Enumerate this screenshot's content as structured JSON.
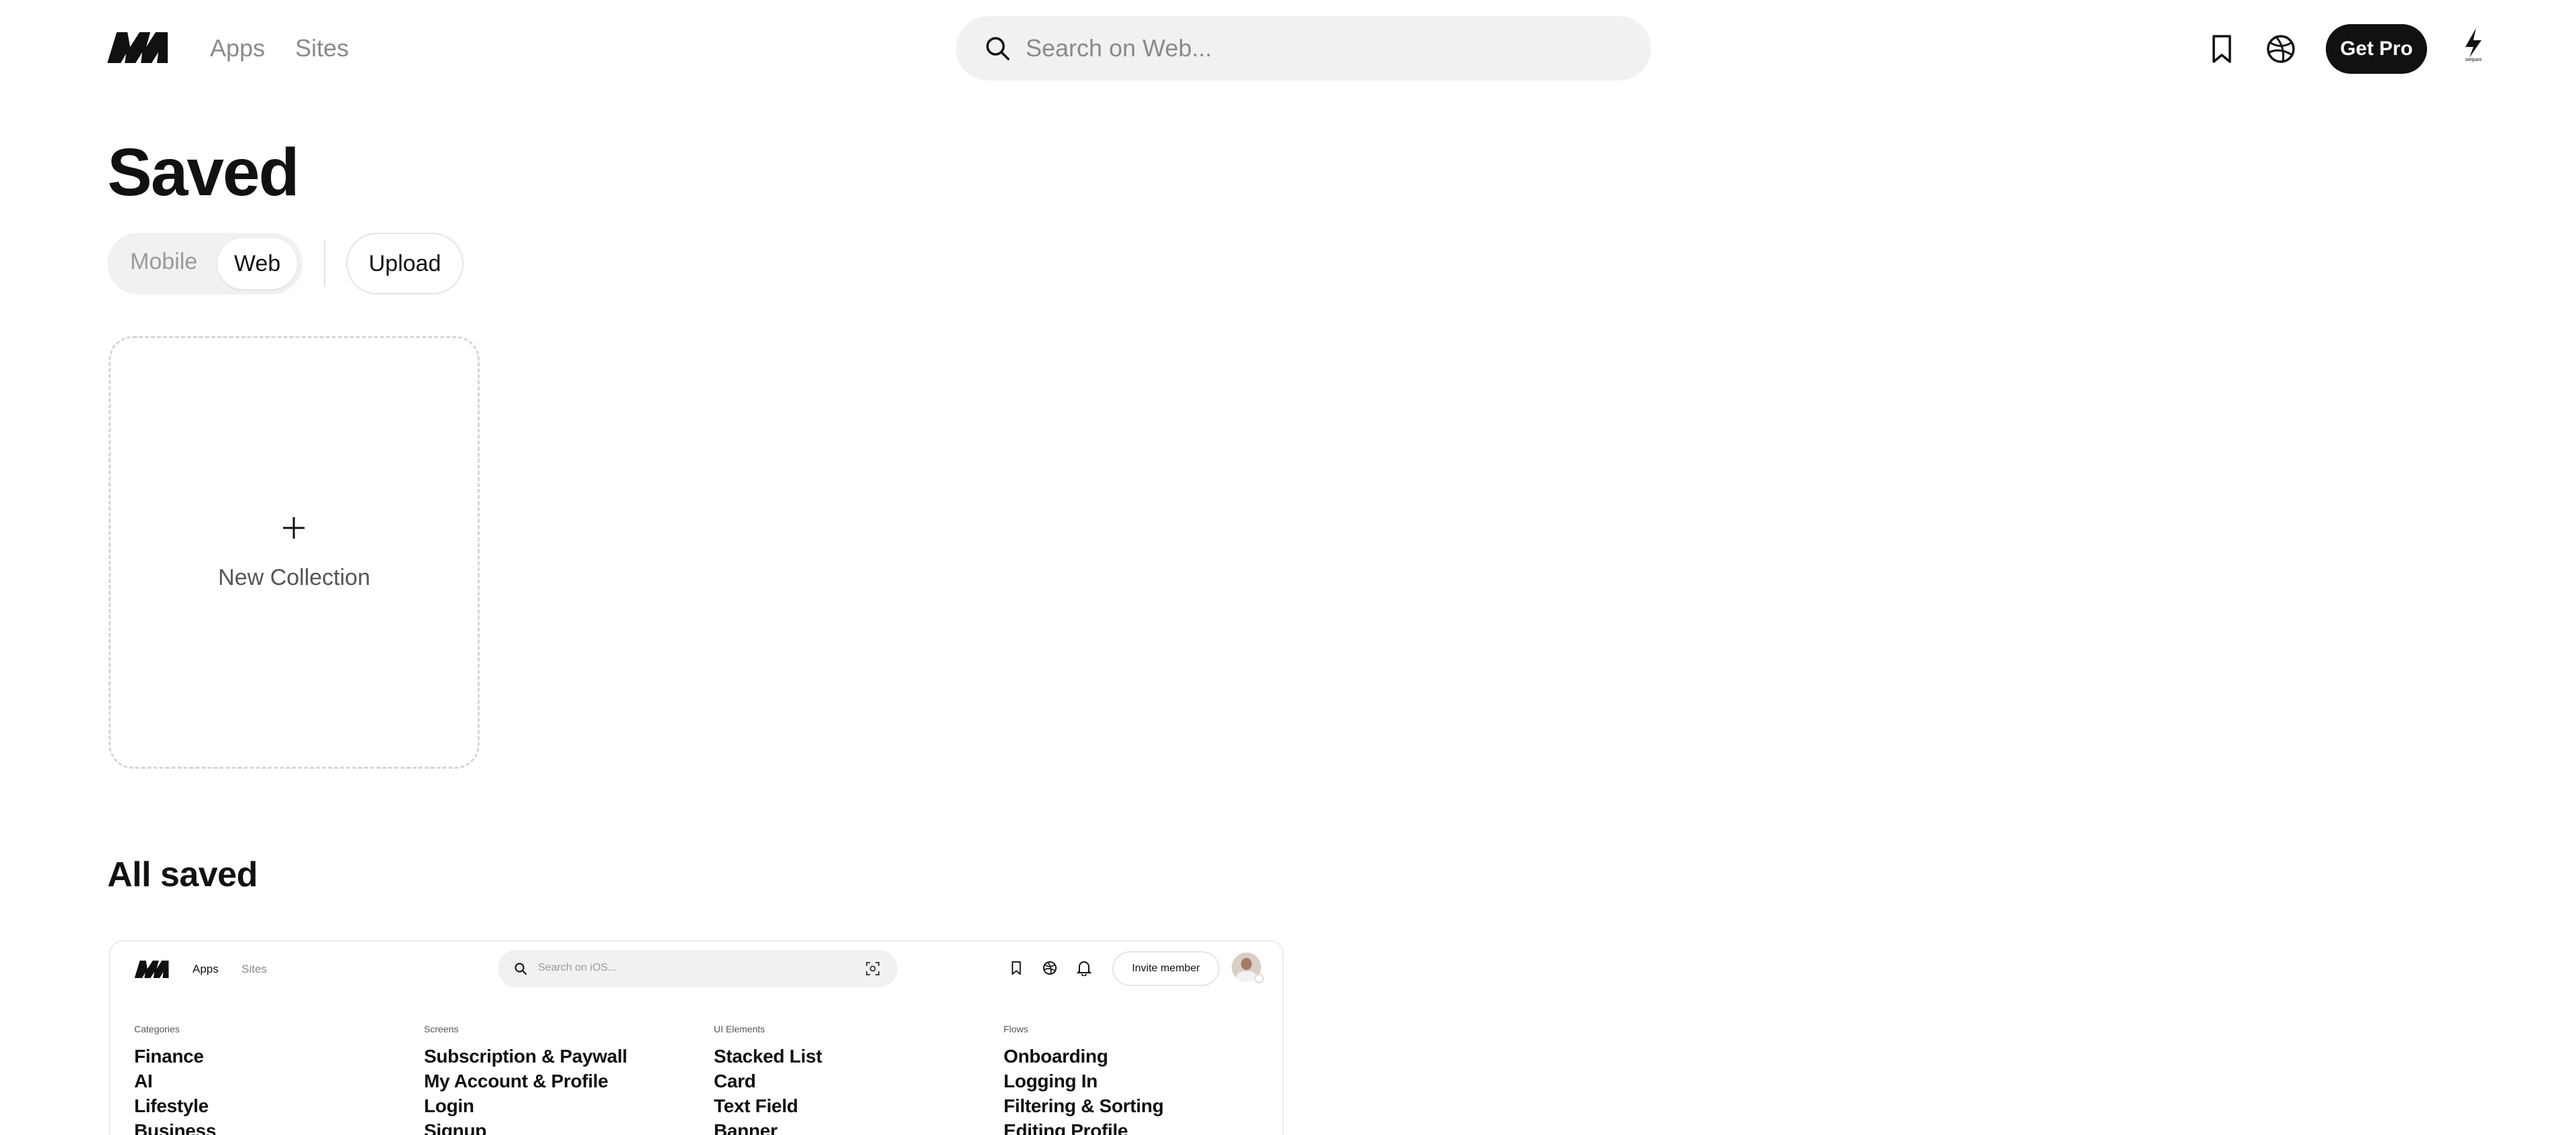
{
  "header": {
    "nav": {
      "apps": "Apps",
      "sites": "Sites"
    },
    "search": {
      "placeholder": "Search on Web..."
    },
    "get_pro": "Get Pro",
    "profile_caption": "stelpant",
    "icons": [
      "brand-logo",
      "search-icon",
      "bookmark-icon",
      "globe-icon",
      "bolt-icon"
    ]
  },
  "page": {
    "title": "Saved"
  },
  "platform_toggle": {
    "mobile": "Mobile",
    "web": "Web",
    "selected": "Web"
  },
  "upload": "Upload",
  "new_collection": {
    "label": "New Collection"
  },
  "all_saved": {
    "title": "All saved"
  },
  "preview": {
    "nav": {
      "apps": "Apps",
      "sites": "Sites"
    },
    "search_placeholder": "Search on iOS...",
    "invite": "Invite member",
    "columns": [
      {
        "heading": "Categories",
        "items": [
          "Finance",
          "AI",
          "Lifestyle",
          "Business"
        ]
      },
      {
        "heading": "Screens",
        "items": [
          "Subscription & Paywall",
          "My Account & Profile",
          "Login",
          "Signup"
        ]
      },
      {
        "heading": "UI Elements",
        "items": [
          "Stacked List",
          "Card",
          "Text Field",
          "Banner"
        ]
      },
      {
        "heading": "Flows",
        "items": [
          "Onboarding",
          "Logging In",
          "Filtering & Sorting",
          "Editing Profile"
        ]
      }
    ]
  },
  "colors": {
    "text": "#111111",
    "muted": "#8a8a8a",
    "surface": "#f1f1f1",
    "accent": "#111111"
  }
}
